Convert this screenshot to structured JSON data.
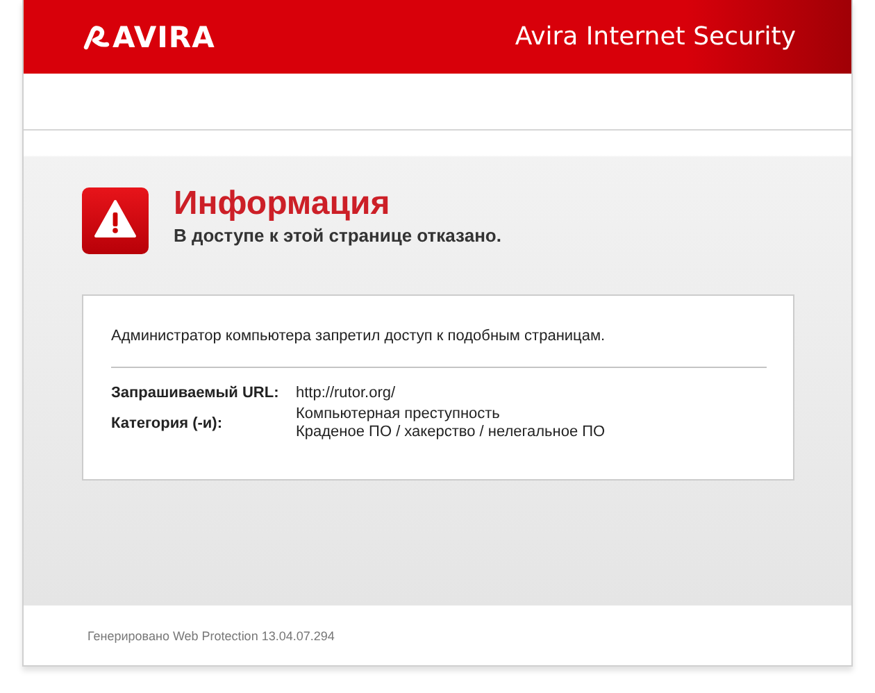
{
  "header": {
    "logo_text": "AVIRA",
    "product": "Avira Internet Security"
  },
  "notice": {
    "title": "Информация",
    "subtitle": "В доступе к этой странице отказано."
  },
  "details": {
    "message": "Администратор компьютера запретил доступ к подобным страницам.",
    "fields": [
      {
        "label": "Запрашиваемый URL:",
        "values": [
          "http://rutor.org/"
        ]
      },
      {
        "label": "Категория (-и):",
        "values": [
          "Компьютерная преступность",
          "Краденое ПО / хакерство / нелегальное ПО"
        ]
      }
    ]
  },
  "footer": "Генерировано Web Protection 13.04.07.294"
}
